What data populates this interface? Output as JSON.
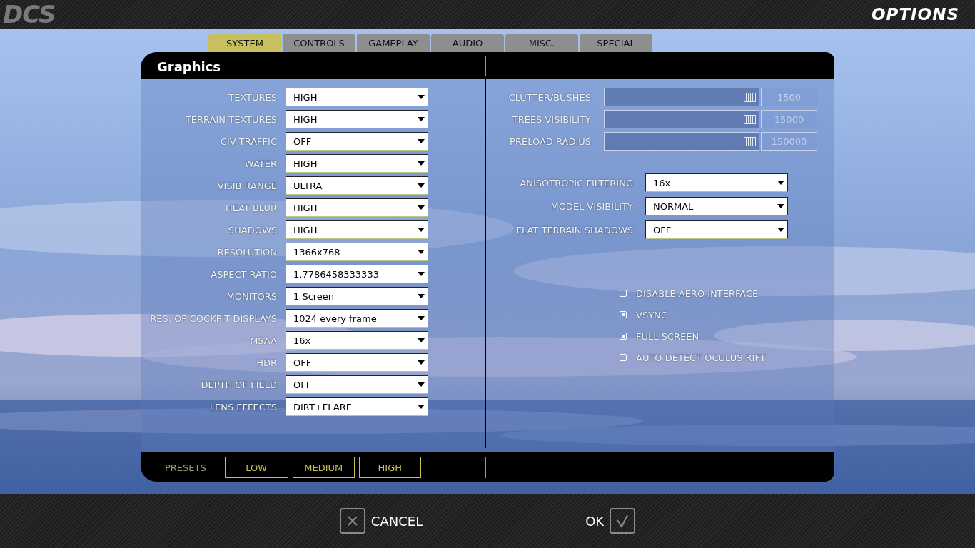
{
  "header": {
    "logo": "DCS",
    "title": "OPTIONS"
  },
  "tabs": [
    {
      "label": "SYSTEM",
      "selected": true
    },
    {
      "label": "CONTROLS",
      "selected": false
    },
    {
      "label": "GAMEPLAY",
      "selected": false
    },
    {
      "label": "AUDIO",
      "selected": false
    },
    {
      "label": "MISC.",
      "selected": false
    },
    {
      "label": "SPECIAL",
      "selected": false
    }
  ],
  "panel": {
    "title": "Graphics",
    "left_settings": [
      {
        "label": "TEXTURES",
        "value": "HIGH"
      },
      {
        "label": "TERRAIN TEXTURES",
        "value": "HIGH"
      },
      {
        "label": "CIV TRAFFIC",
        "value": "OFF"
      },
      {
        "label": "WATER",
        "value": "HIGH"
      },
      {
        "label": "VISIB RANGE",
        "value": "ULTRA"
      },
      {
        "label": "HEAT BLUR",
        "value": "HIGH"
      },
      {
        "label": "SHADOWS",
        "value": "HIGH"
      },
      {
        "label": "RESOLUTION",
        "value": "1366x768"
      },
      {
        "label": "ASPECT RATIO",
        "value": "1.7786458333333"
      },
      {
        "label": "MONITORS",
        "value": "1 Screen"
      },
      {
        "label": "RES. OF COCKPIT DISPLAYS",
        "value": "1024 every frame"
      },
      {
        "label": "MSAA",
        "value": "16x"
      },
      {
        "label": "HDR",
        "value": "OFF"
      },
      {
        "label": "DEPTH OF FIELD",
        "value": "OFF"
      },
      {
        "label": "LENS EFFECTS",
        "value": "DIRT+FLARE"
      }
    ],
    "sliders": [
      {
        "label": "CLUTTER/BUSHES",
        "level": 0.97,
        "value": "1500"
      },
      {
        "label": "TREES VISIBILITY",
        "level": 0.97,
        "value": "15000"
      },
      {
        "label": "PRELOAD RADIUS",
        "level": 0.97,
        "value": "150000"
      }
    ],
    "right_settings": [
      {
        "label": "ANISOTROPIC FILTERING",
        "value": "16x"
      },
      {
        "label": "MODEL VISIBILITY",
        "value": "NORMAL"
      },
      {
        "label": "FLAT TERRAIN SHADOWS",
        "value": "OFF"
      }
    ],
    "checkboxes": [
      {
        "label": "DISABLE AERO INTERFACE",
        "checked": false
      },
      {
        "label": "VSYNC",
        "checked": true
      },
      {
        "label": "FULL SCREEN",
        "checked": true
      },
      {
        "label": "AUTO DETECT OCULUS RIFT",
        "checked": false
      }
    ],
    "presets": {
      "label": "PRESETS",
      "buttons": [
        "LOW",
        "MEDIUM",
        "HIGH"
      ]
    }
  },
  "footer": {
    "cancel": "CANCEL",
    "ok": "OK"
  }
}
